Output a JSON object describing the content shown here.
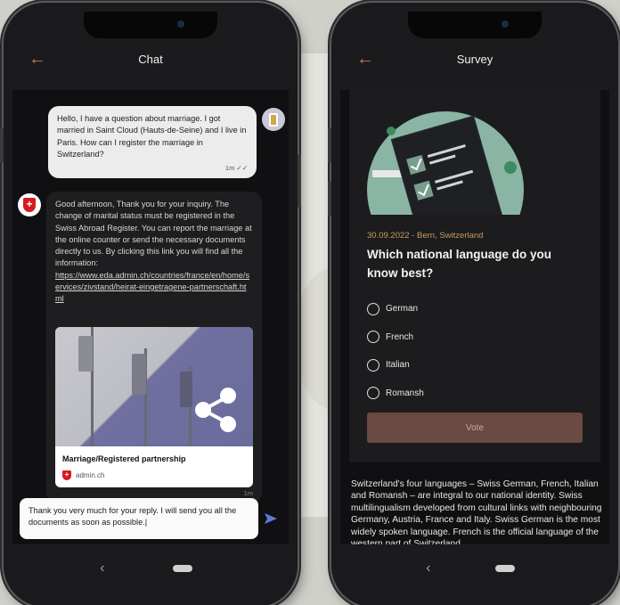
{
  "chat": {
    "title": "Chat",
    "user_message": "Hello, I have a question about marriage. I got married in Saint Cloud (Hauts-de-Seine) and I live in Paris. How can I register the marriage in Switzerland?",
    "user_message_time": "1m ✓✓",
    "bot_message": "Good afternoon, Thank you for your inquiry. The change of marital status must be registered in the Swiss Abroad Register. You can report the marriage at the online counter or send the necessary documents directly to us. By clicking this link you will find all the information:",
    "bot_link": "https://www.eda.admin.ch/countries/france/en/home/services/zivstand/heirat-eingetragene-partnerschaft.html",
    "bot_message_time": "1m",
    "bot_avatar_symbol": "+",
    "link_card": {
      "title": "Marriage/Registered partnership",
      "domain": "admin.ch",
      "domain_symbol": "+"
    },
    "composer_text": "Thank you very much for your reply. I will send you all the documents as soon as possible.",
    "composer_cursor": "|"
  },
  "survey": {
    "title": "Survey",
    "date_location": "30.09.2022 - Bern, Switzerland",
    "question": "Which national language do you know best?",
    "options": [
      "German",
      "French",
      "Italian",
      "Romansh"
    ],
    "vote_label": "Vote",
    "info_text": "Switzerland's four languages – Swiss German, French, Italian and Romansh – are integral to our national identity. Swiss multilingualism developed from cultural links with neighbouring Germany, Austria, France and Italy. Swiss German is the most widely spoken language. French is the official language of the western part of Switzerland."
  },
  "nav": {
    "back_glyph": "‹",
    "topbar_back_glyph": "←"
  },
  "colors": {
    "accent": "#c8745c",
    "vote_button": "#6a4a42",
    "illustration_teal": "#8ab5a4",
    "dark_surface": "#1c1c1e"
  },
  "icons": [
    "back-arrow-icon",
    "share-icon",
    "send-icon",
    "shield-icon",
    "radio-icon",
    "survey-illustration"
  ]
}
